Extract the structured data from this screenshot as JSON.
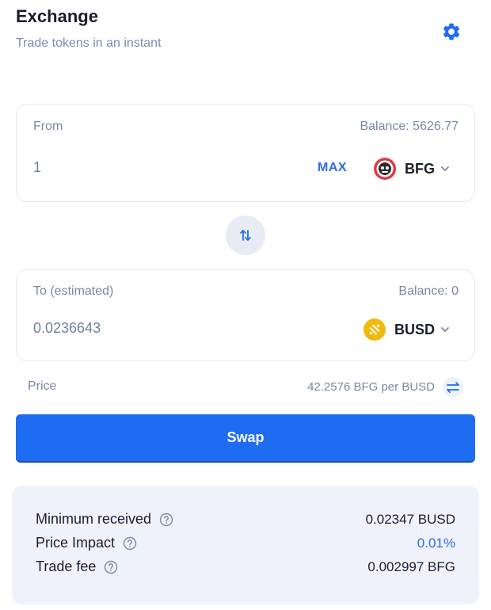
{
  "header": {
    "title": "Exchange",
    "subtitle": "Trade tokens in an instant",
    "settings_icon": "gear-icon"
  },
  "from": {
    "label": "From",
    "balance": "Balance: 5626.77",
    "amount": "1",
    "max_label": "MAX",
    "token": "BFG"
  },
  "switch_icon": "swap-vertical-arrows-icon",
  "to": {
    "label": "To (estimated)",
    "balance": "Balance: 0",
    "amount": "0.0236643",
    "token": "BUSD"
  },
  "price": {
    "label": "Price",
    "value": "42.2576 BFG per BUSD"
  },
  "swap_label": "Swap",
  "details": [
    {
      "label": "Minimum received",
      "value": "0.02347 BUSD"
    },
    {
      "label": "Price Impact",
      "value": "0.01%"
    },
    {
      "label": "Trade fee",
      "value": "0.002997 BFG"
    }
  ],
  "colors": {
    "accent": "#1e6cf2",
    "link": "#2d6bea",
    "muted": "#7a87a3",
    "panel": "#eff2fa",
    "busd": "#f0b90b",
    "bfg": "#e63946"
  }
}
